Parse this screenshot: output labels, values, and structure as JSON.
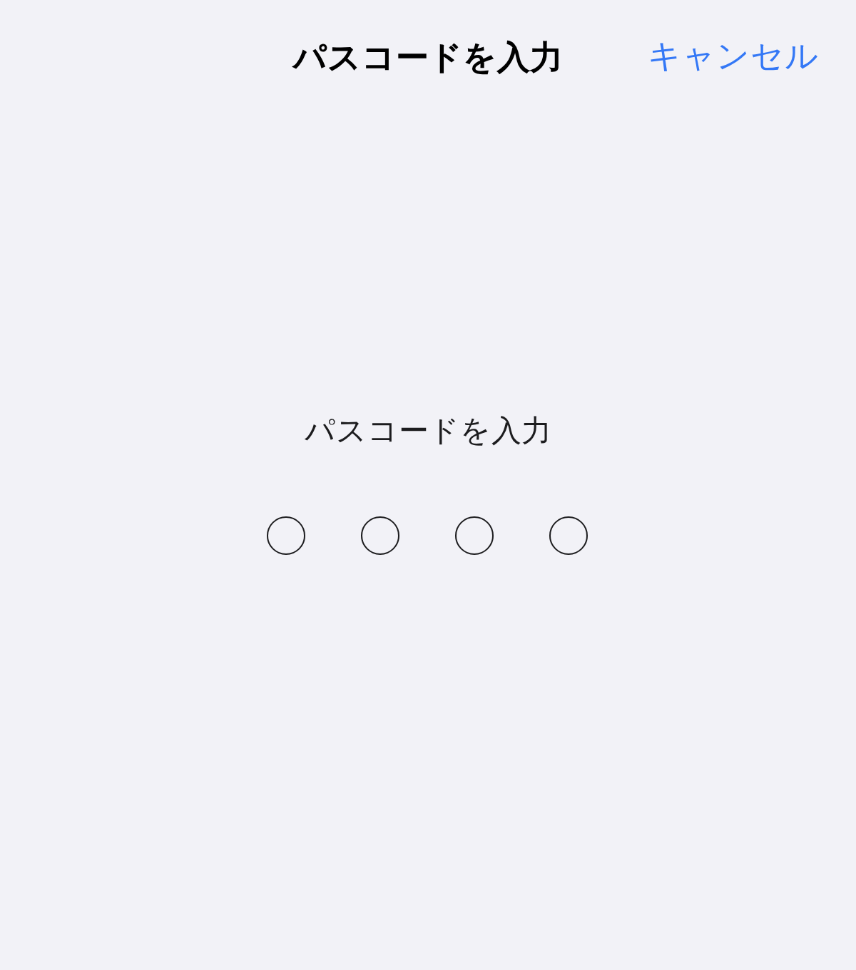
{
  "nav_bar": {
    "title": "パスコードを入力",
    "cancel": "キャンセル"
  },
  "prompt": "パスコードを入力",
  "digits": [
    {
      "filled": false
    },
    {
      "filled": false
    },
    {
      "filled": false
    },
    {
      "filled": false
    }
  ]
}
